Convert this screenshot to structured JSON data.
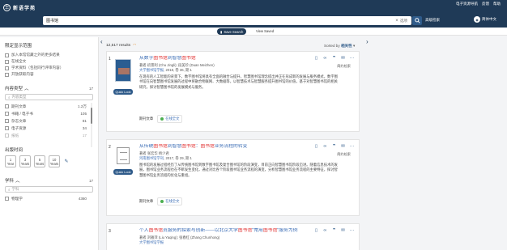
{
  "header": {
    "logo_text": "新语学苑",
    "logo_mark": "华",
    "top_links": [
      "电子资源导航",
      "反馈",
      "帮助"
    ],
    "search_value": "图书馆",
    "search_option": "选项",
    "advanced_label": "高级检索",
    "lang_label": "简体中文"
  },
  "subnav": {
    "save_search": "Save Search",
    "view_saved": "View Saved"
  },
  "sidebar": {
    "title": "限定显示范围",
    "checks": [
      "加入本馆馆藏之外的更多结果",
      "在线全文",
      "学术资料（包括同行评审内容）",
      "开放获取内容"
    ],
    "content_type": {
      "title": "内容类型",
      "count_label": "17",
      "filter_placeholder": "内容类型",
      "items": [
        {
          "label": "期刊文章",
          "count": "1.2万"
        },
        {
          "label": "书籍 / 电子书",
          "count": "105"
        },
        {
          "label": "杂志文章",
          "count": "81"
        },
        {
          "label": "电子资源",
          "count": "34"
        },
        {
          "label": "报纸",
          "count": "17"
        }
      ]
    },
    "pub_date": {
      "title": "出版时间",
      "years": [
        {
          "num": "1",
          "unit": "Year"
        },
        {
          "num": "3",
          "unit": "Years"
        },
        {
          "num": "5",
          "unit": "Years"
        },
        {
          "num": "10",
          "unit": "Years"
        }
      ]
    },
    "subject": {
      "title": "学科",
      "count_label": "17",
      "filter_placeholder": "学科",
      "items": [
        {
          "label": "物理学",
          "count": "4360"
        }
      ]
    }
  },
  "results": {
    "count_text": "12,517 results",
    "sort_label": "Sorted by",
    "sort_value": "相关性",
    "items": [
      {
        "num": "1",
        "title_parts": [
          "从数字",
          "图书馆",
          "到智慧",
          "图书馆"
        ],
        "author": "著者 初景利 (Chu Jingli); 段美珍 (Duan Meizhen)",
        "source_name": "大学图书馆学报",
        "source_rest": ", 2018, 卷 36, 期 1",
        "abstract": "在现有的人工智能的背景下，数字图书馆将具有全面的融合与提升，智慧图书馆理念提出并正在形成新的发展与服务模式，数字图书馆在向智慧图书馆发展的过程中将融合物联网、大数据等，以智慧技术与智慧服务提升图书馆的价值，基于对智慧图书馆的相关研究，探讨智慧图书馆的发展模式与服务。",
        "type": "期刊文章",
        "online": "在线全文",
        "library": "简约检索",
        "quick": "Quick Look"
      },
      {
        "num": "2",
        "title_parts": [
          "从传统",
          "图书馆",
          "到智慧",
          "图书馆",
          "：",
          "图书馆",
          "业务流程的转变"
        ],
        "author": "著者 张宏华 杨少君",
        "source_name": "河南图书馆学刊",
        "source_rest": ", 2017, 卷 29, 期 1",
        "abstract": "图书馆的发展过程经历了从传统图书馆到数字图书馆及复合图书馆的阶段演变，目前正向智慧图书馆阶段迈进。随着信息技术的发展，图书馆业务流程也在不断发生变化，通过对比各个阶段图书馆业务流程的演变，分析智慧图书馆业务流程的主要特征，探讨智慧图书馆业务流程的优化与重组。",
        "type": "期刊文章",
        "online": "在线全文",
        "library": "简约检索",
        "quick": "Quick Look"
      },
      {
        "num": "3",
        "title_parts": [
          "个人",
          "图书馆",
          "员服务的探索与创新——以北京大学",
          "图书馆",
          "\"常用",
          "图书馆",
          "\"服务为例"
        ],
        "author": "著者 刘雅萍 (Liu Yaqing); 张春红 (Zhang Chunhong)",
        "source_name": "大学图书馆学报",
        "source_rest": ""
      }
    ]
  }
}
